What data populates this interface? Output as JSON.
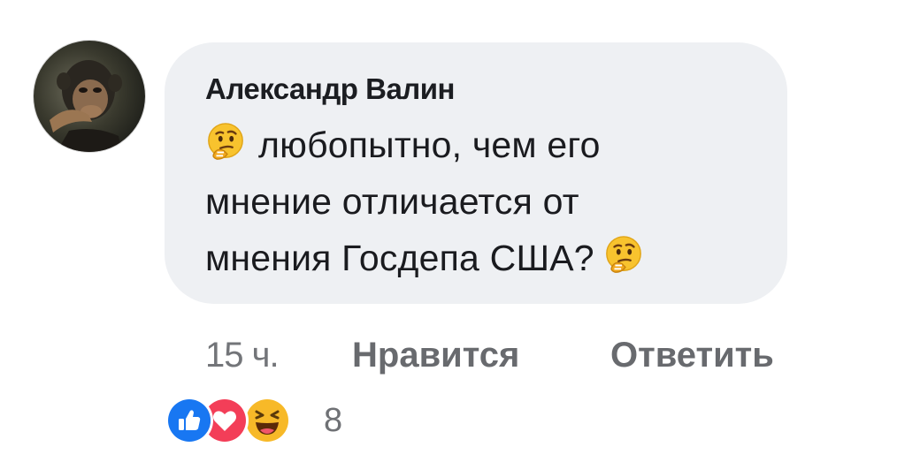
{
  "comment": {
    "author": "Александр Валин",
    "text_lines": [
      "любопытно, чем его",
      "мнение отличается от",
      "мнения Госдепа США?"
    ],
    "emoji": "thinking-face-emoji"
  },
  "actions": {
    "time": "15 ч.",
    "like_label": "Нравится",
    "reply_label": "Ответить"
  },
  "reactions": {
    "icons": [
      "like-icon",
      "love-icon",
      "haha-icon"
    ],
    "count": "8"
  },
  "colors": {
    "bubble": "#eef0f3",
    "like_blue": "#1877f2",
    "love_red": "#f33e58",
    "haha_yellow": "#f7b928"
  }
}
